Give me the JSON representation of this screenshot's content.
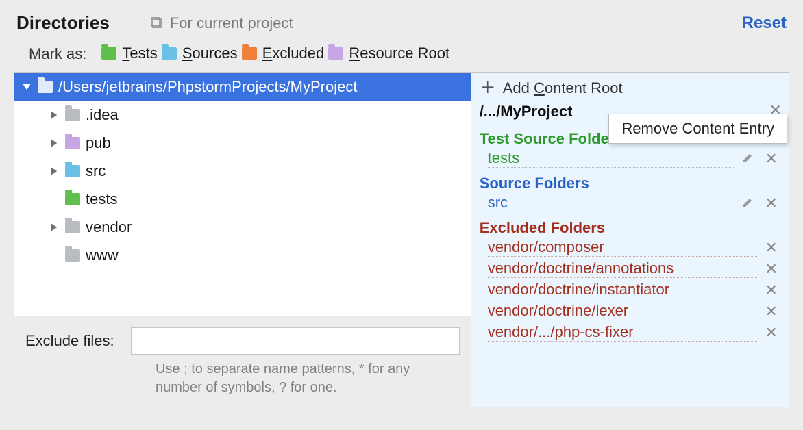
{
  "header": {
    "title": "Directories",
    "scope_label": "For current project",
    "reset_label": "Reset"
  },
  "markas": {
    "label": "Mark as:",
    "items": [
      {
        "label": "Tests",
        "color": "green"
      },
      {
        "label": "Sources",
        "color": "blue"
      },
      {
        "label": "Excluded",
        "color": "orange"
      },
      {
        "label": "Resource Root",
        "color": "purple"
      }
    ]
  },
  "tree": {
    "root_path": "/Users/jetbrains/PhpstormProjects/MyProject",
    "items": [
      {
        "name": ".idea",
        "color": "grey",
        "expandable": true
      },
      {
        "name": "pub",
        "color": "purple",
        "expandable": true
      },
      {
        "name": "src",
        "color": "blue",
        "expandable": true
      },
      {
        "name": "tests",
        "color": "green",
        "expandable": false
      },
      {
        "name": "vendor",
        "color": "grey",
        "expandable": true
      },
      {
        "name": "www",
        "color": "grey",
        "expandable": false
      }
    ]
  },
  "exclude": {
    "label": "Exclude files:",
    "value": "",
    "hint": "Use ; to separate name patterns, * for any number of symbols, ? for one."
  },
  "right": {
    "add_label": "Add Content Root",
    "root_path": "/.../MyProject",
    "tooltip": "Remove Content Entry",
    "sections": [
      {
        "title": "Test Source Folders",
        "style": "green",
        "entries": [
          {
            "name": "tests",
            "editable": true
          }
        ]
      },
      {
        "title": "Source Folders",
        "style": "blue",
        "entries": [
          {
            "name": "src",
            "editable": true
          }
        ]
      },
      {
        "title": "Excluded Folders",
        "style": "red",
        "entries": [
          {
            "name": "vendor/composer"
          },
          {
            "name": "vendor/doctrine/annotations"
          },
          {
            "name": "vendor/doctrine/instantiator"
          },
          {
            "name": "vendor/doctrine/lexer"
          },
          {
            "name": "vendor/.../php-cs-fixer"
          }
        ]
      }
    ]
  }
}
